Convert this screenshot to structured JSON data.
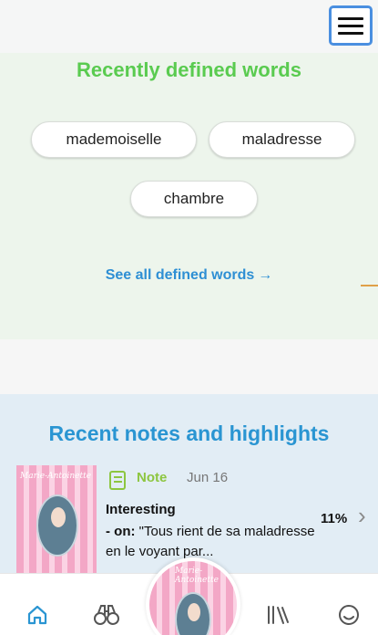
{
  "header": {
    "menu_icon": "hamburger-menu-icon"
  },
  "defined_words": {
    "title": "Recently defined words",
    "words": [
      "mademoiselle",
      "maladresse",
      "chambre"
    ],
    "see_all_label": "See all defined words",
    "see_all_arrow": "→"
  },
  "recent_notes": {
    "title": "Recent notes and highlights",
    "items": [
      {
        "type": "Note",
        "date": "Jun 16",
        "heading": "Interesting",
        "on_label": "- on:",
        "quote": "\"Tous rient de sa maladresse en le voyant par...",
        "progress": "11%",
        "progress_value": 0.11,
        "book_cover_text": "Marie-Antoinette",
        "icons": {
          "type": "note-icon",
          "open": "chevron-right-icon"
        }
      }
    ]
  },
  "bottom_nav": {
    "items": [
      {
        "id": "home",
        "icon": "home-icon",
        "active": true
      },
      {
        "id": "discover",
        "icon": "binoculars-icon",
        "active": false
      },
      {
        "id": "current-book",
        "icon": "book-cover",
        "active": false
      },
      {
        "id": "library",
        "icon": "library-icon",
        "active": false
      },
      {
        "id": "profile",
        "icon": "smiley-icon",
        "active": false
      }
    ],
    "current_book_cover_text": "Marie-Antoinette"
  },
  "colors": {
    "defined_title": "#5acb50",
    "notes_title": "#2a95d2",
    "link": "#2e8fd4",
    "note_green": "#8dc640",
    "nav_active": "#2a95d2",
    "nav_inactive": "#666666",
    "defined_bg": "#edf5ec",
    "notes_bg": "#e2edf5"
  }
}
